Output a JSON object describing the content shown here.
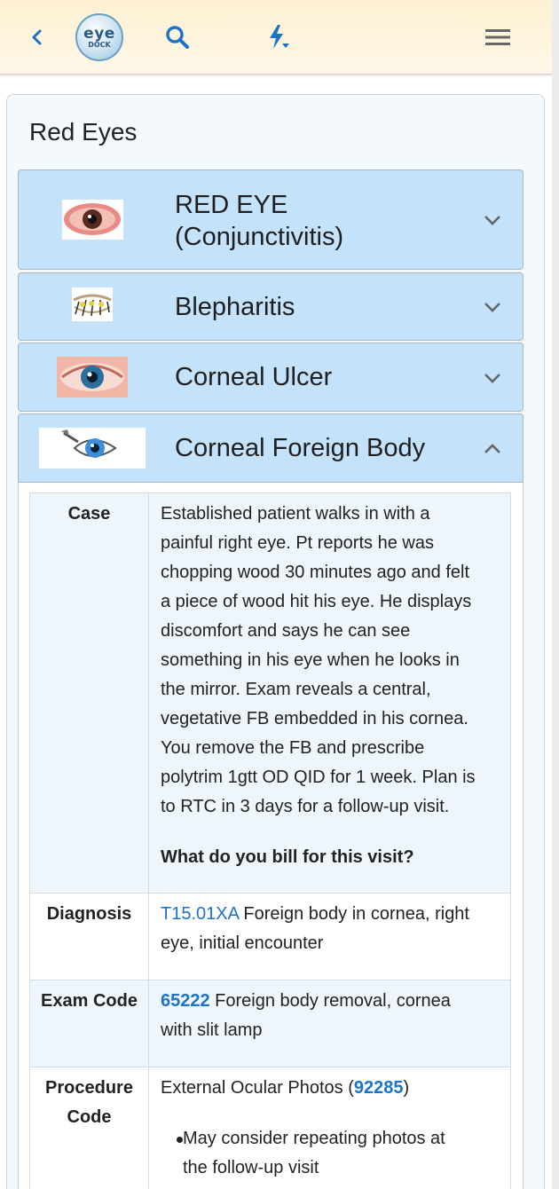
{
  "header": {
    "logo_top": "eye",
    "logo_bottom": "DOCK",
    "accent": "#1a73c6"
  },
  "page": {
    "title": "Red Eyes"
  },
  "accordion": [
    {
      "title_line1": "RED EYE",
      "title_line2": "(Conjunctivitis)",
      "expanded": false
    },
    {
      "title": "Blepharitis",
      "expanded": false
    },
    {
      "title": "Corneal Ulcer",
      "expanded": false
    },
    {
      "title": "Corneal Foreign Body",
      "expanded": true
    }
  ],
  "table": {
    "case": {
      "label": "Case",
      "lines": [
        "Established patient walks in with a",
        "painful right eye. Pt reports he was",
        "chopping wood 30 minutes ago and felt",
        "a piece of wood hit his eye. He displays",
        "discomfort and says he can see",
        "something in his eye when he looks in",
        "the mirror. Exam reveals a central,",
        "vegetative FB embedded in his cornea.",
        "You remove the FB and prescribe",
        "polytrim 1gtt OD QID for 1 week. Plan is",
        "to RTC in 3 days for a follow-up visit."
      ],
      "question": "What do you bill for this visit?"
    },
    "diagnosis": {
      "label": "Diagnosis",
      "code": "T15.01XA",
      "text_line1": " Foreign body in cornea, right",
      "text_line2": "eye, initial encounter"
    },
    "exam": {
      "label": "Exam Code",
      "code": "65222",
      "text_line1": " Foreign body removal, cornea",
      "text_line2": "with slit lamp"
    },
    "procedure": {
      "label_line1": "Procedure",
      "label_line2": "Code",
      "text_prefix": "External Ocular Photos (",
      "code": "92285",
      "text_suffix": ")",
      "bullet_line1": "May consider repeating photos at",
      "bullet_line2": "the follow-up visit"
    }
  }
}
